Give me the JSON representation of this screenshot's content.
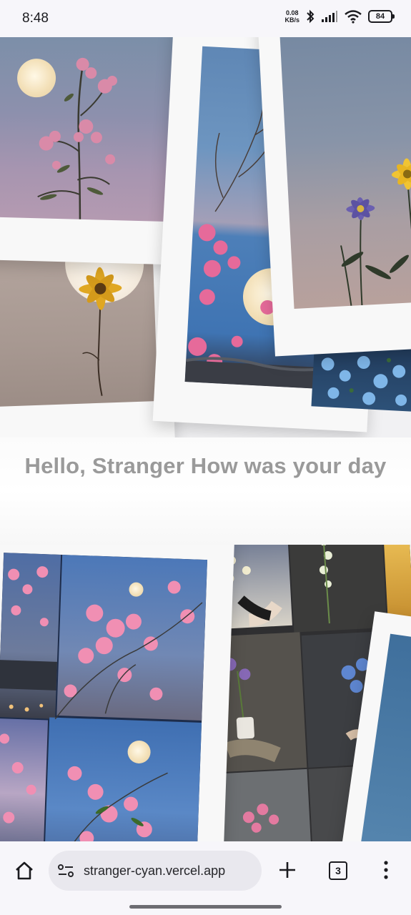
{
  "status_bar": {
    "time": "8:48",
    "net_speed_value": "0.08",
    "net_speed_unit": "KB/s",
    "battery": "84",
    "icons": [
      "bluetooth-icon",
      "signal-icon",
      "wifi-icon",
      "battery-icon"
    ]
  },
  "page": {
    "tagline": "Hello, Stranger How was your day",
    "photos": [
      "moon-pink-blossom-photo",
      "moon-branches-blossom-photo",
      "yellow-purple-flowers-photo",
      "daisy-moon-photo",
      "blue-flowers-strip-photo",
      "pink-blossom-moon-collage-photo",
      "hands-holding-flowers-collage-photo",
      "sky-partial-photo"
    ]
  },
  "browser": {
    "url": "stranger-cyan.vercel.app",
    "tab_count": "3",
    "icons": [
      "home-icon",
      "site-settings-icon",
      "new-tab-icon",
      "tabs-icon",
      "menu-icon"
    ]
  },
  "colors": {
    "tagline": "#9a9a9a",
    "background": "#f1f1f3",
    "browser_bar": "#f7f6fa"
  }
}
